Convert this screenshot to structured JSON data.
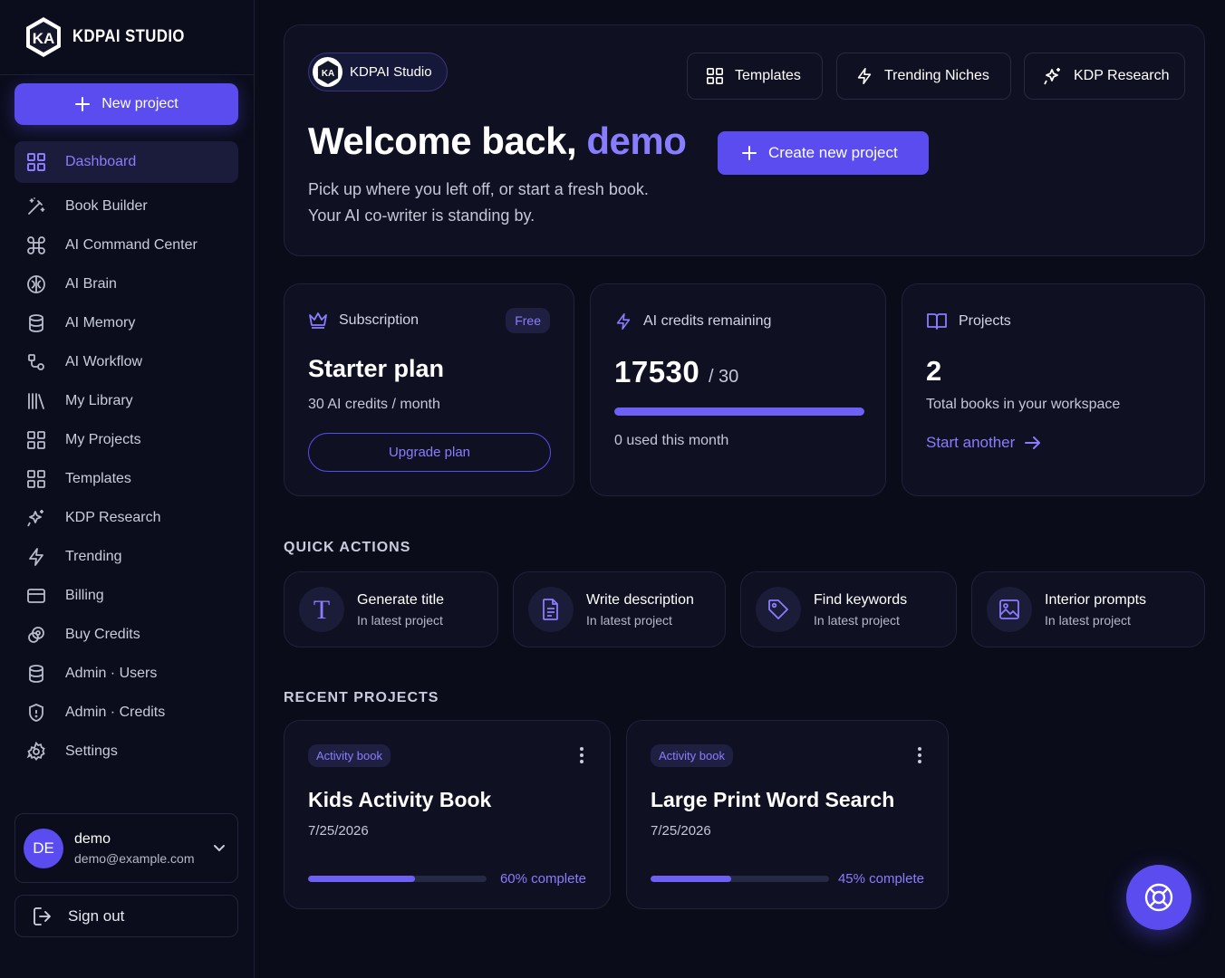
{
  "brand": {
    "name": "KDPAI STUDIO"
  },
  "sidebar": {
    "new_project_label": "New project",
    "items": [
      {
        "label": "Dashboard",
        "icon": "grid-icon",
        "active": true
      },
      {
        "label": "Book Builder",
        "icon": "magic-wand-icon"
      },
      {
        "label": "AI Command Center",
        "icon": "command-icon"
      },
      {
        "label": "AI Brain",
        "icon": "brain-icon"
      },
      {
        "label": "AI Memory",
        "icon": "database-icon"
      },
      {
        "label": "AI Workflow",
        "icon": "workflow-icon"
      },
      {
        "label": "My Library",
        "icon": "library-icon"
      },
      {
        "label": "My Projects",
        "icon": "grid-icon"
      },
      {
        "label": "Templates",
        "icon": "grid-icon"
      },
      {
        "label": "KDP Research",
        "icon": "sparkles-icon"
      },
      {
        "label": "Trending",
        "icon": "lightning-icon"
      },
      {
        "label": "Billing",
        "icon": "credit-card-icon"
      },
      {
        "label": "Buy Credits",
        "icon": "coins-icon"
      },
      {
        "label": "Admin · Users",
        "icon": "database-icon"
      },
      {
        "label": "Admin · Credits",
        "icon": "shield-icon"
      },
      {
        "label": "Settings",
        "icon": "gear-icon"
      }
    ],
    "user": {
      "initials": "DE",
      "name": "demo",
      "email": "demo@example.com"
    },
    "sign_out_label": "Sign out"
  },
  "hero": {
    "badge_label": "KDPAI Studio",
    "top_buttons": [
      {
        "label": "Templates",
        "icon": "grid-icon"
      },
      {
        "label": "Trending Niches",
        "icon": "lightning-icon"
      },
      {
        "label": "KDP Research",
        "icon": "sparkles-icon"
      }
    ],
    "title_prefix": "Welcome back, ",
    "title_user": "demo",
    "subtitle_line1": "Pick up where you left off, or start a fresh book.",
    "subtitle_line2": "Your AI co-writer is standing by.",
    "create_label": "Create new project"
  },
  "stats": {
    "subscription": {
      "label": "Subscription",
      "tag": "Free",
      "plan": "Starter plan",
      "detail": "30 AI credits / month",
      "upgrade_label": "Upgrade plan"
    },
    "credits": {
      "label": "AI credits remaining",
      "remaining": "17530",
      "total": "/ 30",
      "used_text": "0 used this month",
      "fill_fraction": 1.0
    },
    "projects": {
      "label": "Projects",
      "count": "2",
      "detail": "Total books in your workspace",
      "link_label": "Start another"
    }
  },
  "quick_actions": {
    "heading": "QUICK ACTIONS",
    "items": [
      {
        "title": "Generate title",
        "sub": "In latest project",
        "icon": "text-t-icon"
      },
      {
        "title": "Write description",
        "sub": "In latest project",
        "icon": "document-icon"
      },
      {
        "title": "Find keywords",
        "sub": "In latest project",
        "icon": "tag-icon"
      },
      {
        "title": "Interior prompts",
        "sub": "In latest project",
        "icon": "image-icon"
      }
    ]
  },
  "recent_projects": {
    "heading": "RECENT PROJECTS",
    "items": [
      {
        "tag": "Activity book",
        "title": "Kids Activity Book",
        "date": "7/25/2026",
        "progress": 0.6,
        "progress_label": "60% complete"
      },
      {
        "tag": "Activity book",
        "title": "Large Print Word Search",
        "date": "7/25/2026",
        "progress": 0.45,
        "progress_label": "45% complete"
      }
    ]
  },
  "colors": {
    "accent": "#5b4cf0",
    "accent_text": "#8a7cff",
    "background": "#0a0c1a",
    "card": "#0f1122"
  }
}
